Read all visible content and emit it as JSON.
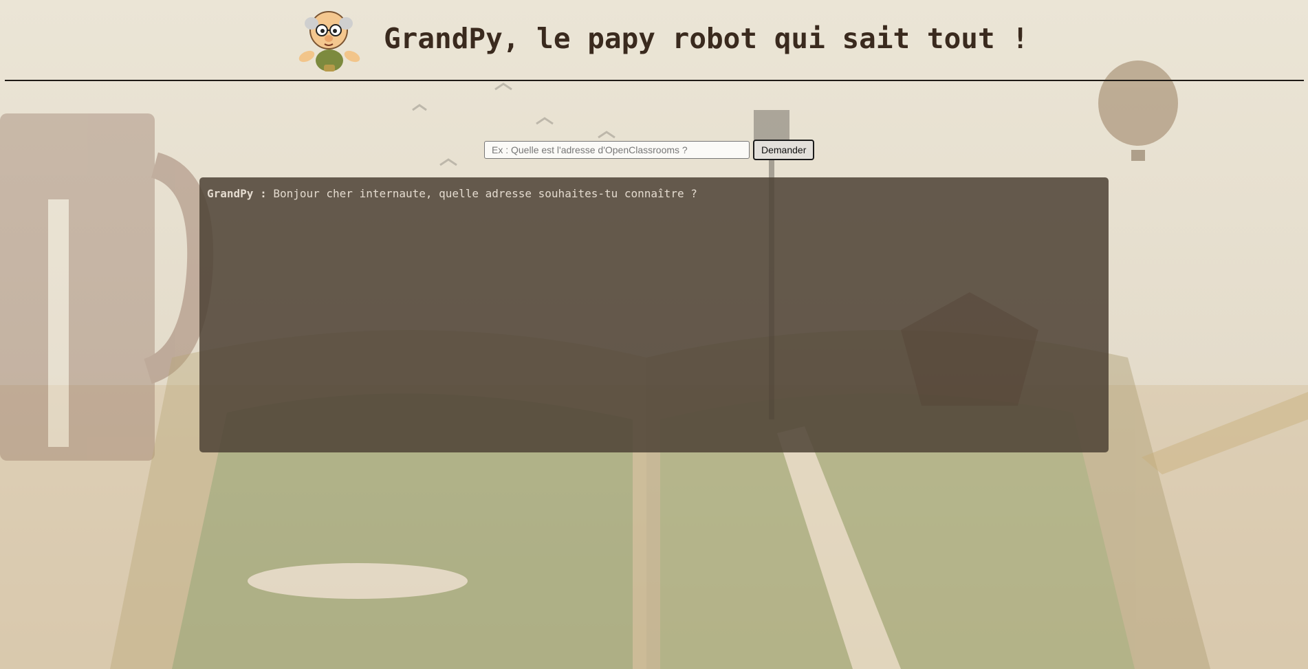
{
  "header": {
    "title": "GrandPy, le papy robot qui sait tout !",
    "logo_icon": "grandpa-robot-avatar-icon"
  },
  "search": {
    "placeholder": "Ex : Quelle est l'adresse d'OpenClassrooms ?",
    "value": "",
    "button_label": "Demander"
  },
  "chat": {
    "messages": [
      {
        "speaker": "GrandPy :",
        "text": "Bonjour cher internaute, quelle adresse souhaites-tu connaître ?"
      }
    ]
  },
  "colors": {
    "page_background": "#e6dfcf",
    "title_text": "#3a2a1e",
    "chat_panel": "#4e4236",
    "chat_text": "#e4dbcf"
  }
}
